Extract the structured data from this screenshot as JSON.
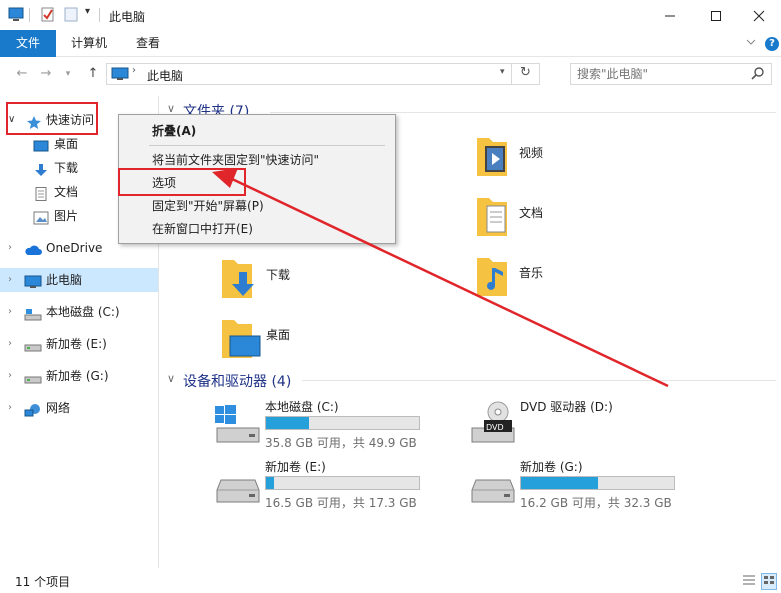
{
  "window": {
    "title": "此电脑",
    "controls": [
      "minimize",
      "maximize",
      "close"
    ],
    "qa_dropdown": "▾"
  },
  "ribbon": {
    "tabs": [
      {
        "label": "文件",
        "active": true
      },
      {
        "label": "计算机",
        "active": false
      },
      {
        "label": "查看",
        "active": false
      }
    ],
    "expand_icon": "chevron-down-icon",
    "help_icon": "help-icon"
  },
  "address": {
    "path": "此电脑",
    "search_placeholder": "搜索\"此电脑\""
  },
  "sidebar": {
    "items": [
      {
        "label": "快速访问",
        "icon": "star-icon",
        "level": 0
      },
      {
        "label": "桌面",
        "icon": "desktop-icon",
        "level": 1
      },
      {
        "label": "下载",
        "icon": "download-icon",
        "level": 1
      },
      {
        "label": "文档",
        "icon": "document-icon",
        "level": 1
      },
      {
        "label": "图片",
        "icon": "picture-icon",
        "level": 1
      },
      {
        "label": "OneDrive",
        "icon": "cloud-icon",
        "level": 0
      },
      {
        "label": "此电脑",
        "icon": "computer-icon",
        "level": 0,
        "selected": true
      },
      {
        "label": "本地磁盘 (C:)",
        "icon": "drive-icon",
        "level": 0
      },
      {
        "label": "新加卷 (E:)",
        "icon": "drive-icon",
        "level": 0
      },
      {
        "label": "新加卷 (G:)",
        "icon": "drive-icon",
        "level": 0
      },
      {
        "label": "网络",
        "icon": "network-icon",
        "level": 0
      }
    ]
  },
  "content": {
    "folders_header": "文件夹 (7)",
    "folders": [
      {
        "label": "视频",
        "icon": "video-folder-icon"
      },
      {
        "label": "文档",
        "icon": "document-folder-icon"
      },
      {
        "label": "下载",
        "icon": "download-folder-icon"
      },
      {
        "label": "音乐",
        "icon": "music-folder-icon"
      },
      {
        "label": "桌面",
        "icon": "desktop-folder-icon"
      }
    ],
    "devices_header": "设备和驱动器 (4)",
    "drives": [
      {
        "name": "本地磁盘 (C:)",
        "detail": "35.8 GB 可用，共 49.9 GB",
        "used_fraction": 0.28,
        "icon": "windows-drive-icon"
      },
      {
        "name": "DVD 驱动器 (D:)",
        "detail": "",
        "used_fraction": null,
        "icon": "dvd-drive-icon"
      },
      {
        "name": "新加卷 (E:)",
        "detail": "16.5 GB 可用，共 17.3 GB",
        "used_fraction": 0.05,
        "icon": "drive-icon"
      },
      {
        "name": "新加卷 (G:)",
        "detail": "16.2 GB 可用，共 32.3 GB",
        "used_fraction": 0.5,
        "icon": "drive-icon"
      }
    ]
  },
  "context_menu": {
    "items": [
      {
        "label": "折叠(A)",
        "bold": true
      },
      {
        "label": "将当前文件夹固定到\"快速访问\""
      },
      {
        "label": "选项",
        "highlighted": true
      },
      {
        "label": "固定到\"开始\"屏幕(P)"
      },
      {
        "label": "在新窗口中打开(E)"
      }
    ]
  },
  "status": {
    "item_count": "11 个项目"
  },
  "colors": {
    "accent": "#1979ca",
    "selected_bg": "#cce8ff",
    "annotation_red": "#e0262b",
    "header_text": "#1e3287"
  }
}
